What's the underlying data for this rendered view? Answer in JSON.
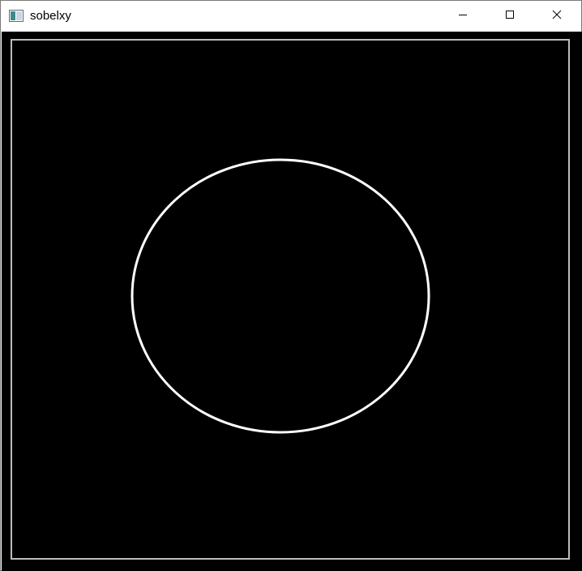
{
  "window": {
    "title": "sobelxy",
    "app_icon": "window-app-icon",
    "controls": {
      "minimize": "minimize-icon",
      "maximize": "maximize-icon",
      "close": "close-icon"
    }
  },
  "image": {
    "background_color": "#000000",
    "edge_color": "#ffffff",
    "frame_color": "#bdbdbd",
    "shapes": [
      "rectangle-border-edge",
      "ellipse-edge"
    ]
  }
}
